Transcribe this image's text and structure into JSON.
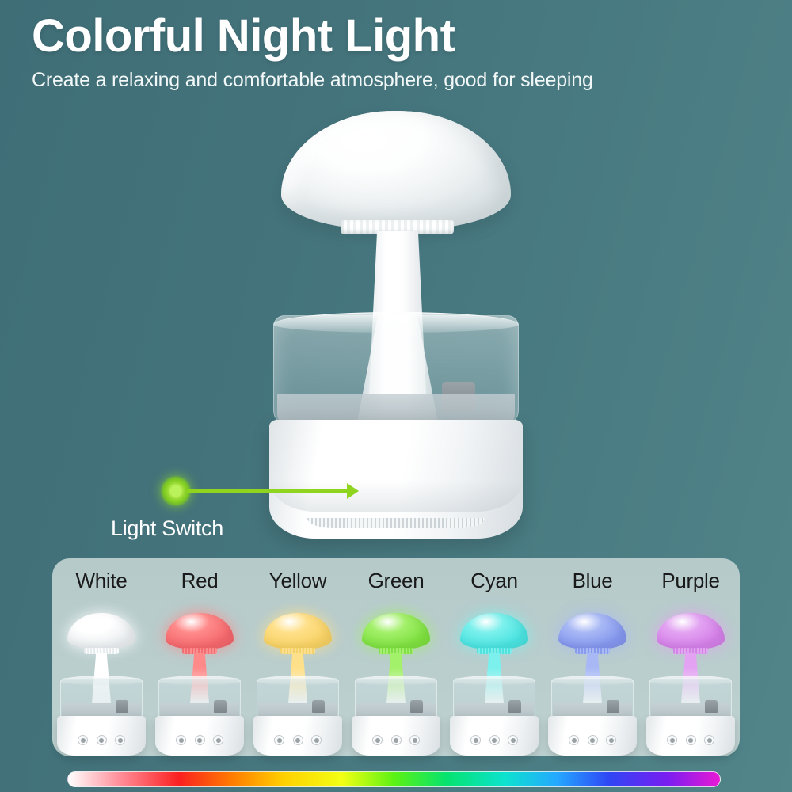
{
  "header": {
    "title": "Colorful Night Light",
    "subtitle": "Create a relaxing and comfortable atmosphere, good for sleeping"
  },
  "callout": {
    "label": "Light Switch",
    "dot_color": "#9ede34",
    "line_color": "#8fd41f",
    "points_to": "light-switch-button"
  },
  "controls": [
    {
      "name": "light-switch-button",
      "icon": "sun-icon",
      "glyph": "☀"
    },
    {
      "name": "power-button",
      "icon": "power-icon",
      "glyph": "⏻"
    },
    {
      "name": "mist-button",
      "icon": "water-drops-icon",
      "glyph": "⁂"
    }
  ],
  "product": {
    "type": "mushroom rain cloud humidifier night light",
    "body_color": "#ffffff",
    "tank": "transparent"
  },
  "swatches": [
    {
      "label": "White",
      "cap": "#ffffff",
      "cap_dark": "#e9edef",
      "glow": "rgba(255,255,255,0.85)"
    },
    {
      "label": "Red",
      "cap": "#ff8a8a",
      "cap_dark": "#f4676c",
      "glow": "rgba(255,138,138,0.85)"
    },
    {
      "label": "Yellow",
      "cap": "#ffe08a",
      "cap_dark": "#f7d264",
      "glow": "rgba(255,224,138,0.85)"
    },
    {
      "label": "Green",
      "cap": "#a3f06a",
      "cap_dark": "#7ee03f",
      "glow": "rgba(163,240,106,0.85)"
    },
    {
      "label": "Cyan",
      "cap": "#7bf0ec",
      "cap_dark": "#49e3e0",
      "glow": "rgba(123,240,236,0.85)"
    },
    {
      "label": "Blue",
      "cap": "#a8b8f5",
      "cap_dark": "#8496ee",
      "glow": "rgba(168,184,245,0.85)"
    },
    {
      "label": "Purple",
      "cap": "#e3a3f2",
      "cap_dark": "#d47fe8",
      "glow": "rgba(227,163,242,0.85)"
    }
  ],
  "gradient_bar": {
    "name": "color-spectrum-bar",
    "stops": [
      "#ffffff",
      "#ff8d98",
      "#fa2020",
      "#ff7a00",
      "#ffd000",
      "#f3ff14",
      "#5cf214",
      "#06e36e",
      "#0ce2cf",
      "#25a8ff",
      "#2f46f5",
      "#7a1df0",
      "#e81ad4"
    ]
  },
  "theme": {
    "background": "#44737b",
    "panel": "#b9cdcd",
    "title_color": "#ffffff"
  }
}
